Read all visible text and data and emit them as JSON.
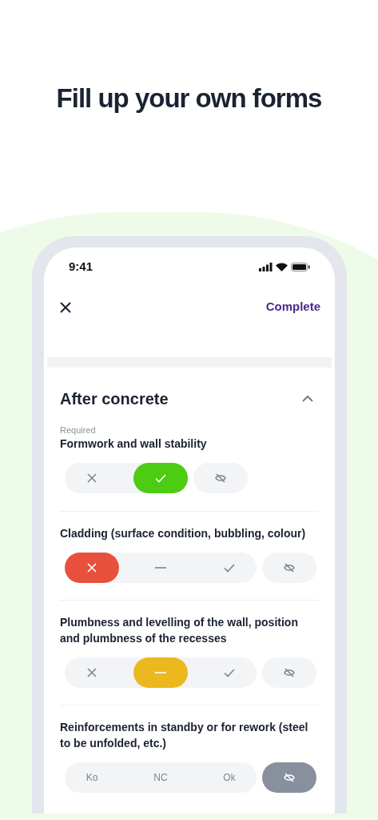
{
  "headline": "Fill up your own forms",
  "status_bar": {
    "time": "9:41"
  },
  "header": {
    "action": "Complete"
  },
  "section": {
    "title": "After concrete",
    "expanded": true,
    "items": [
      {
        "required_label": "Required",
        "question": "Formwork and wall stability",
        "options": [
          {
            "kind": "ko",
            "selected": false
          },
          {
            "kind": "ok",
            "selected": true
          }
        ],
        "na": {
          "selected": false
        }
      },
      {
        "question": "Cladding (surface condition, bubbling, colour)",
        "options": [
          {
            "kind": "ko",
            "selected": true
          },
          {
            "kind": "nc",
            "selected": false
          },
          {
            "kind": "ok",
            "selected": false
          }
        ],
        "na": {
          "selected": false
        }
      },
      {
        "question": "Plumbness and levelling of the wall, position and plumbness of the recesses",
        "options": [
          {
            "kind": "ko",
            "selected": false
          },
          {
            "kind": "nc",
            "selected": true
          },
          {
            "kind": "ok",
            "selected": false
          }
        ],
        "na": {
          "selected": false
        }
      },
      {
        "question": "Reinforcements in standby or for rework (steel to be unfolded, etc.)",
        "options": [
          {
            "label": "Ko",
            "selected": false
          },
          {
            "label": "NC",
            "selected": false
          },
          {
            "label": "Ok",
            "selected": false
          }
        ],
        "na": {
          "selected": true
        }
      }
    ]
  }
}
